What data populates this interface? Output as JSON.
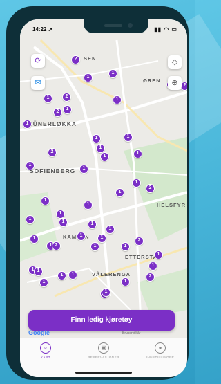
{
  "status_bar": {
    "time": "14:22 ➚",
    "icons": "▮▮ ◠ ▭"
  },
  "map": {
    "districts": [
      "SEN",
      "ØREN",
      "GRÜNERLØKKA",
      "SOFIENBERG",
      "HELSFYR",
      "KAMPEN",
      "ETTERSTAD",
      "VÅLERENGA"
    ],
    "markers": [
      "2",
      "1",
      "1",
      "1",
      "2",
      "1",
      "2",
      "1",
      "1",
      "2",
      "1",
      "1",
      "1",
      "1",
      "2",
      "1",
      "1",
      "1",
      "1",
      "1",
      "2",
      "1",
      "1",
      "1",
      "1",
      "1",
      "1",
      "1",
      "1",
      "1",
      "1",
      "1",
      "1",
      "1",
      "2",
      "1",
      "2",
      "1",
      "1",
      "1",
      "1",
      "1",
      "2",
      "1",
      "1",
      "1",
      "1",
      "1"
    ],
    "google_label": "Google",
    "legal_text": "Brukervilkår"
  },
  "controls": {
    "reload_icon": "reload-icon",
    "messenger_icon": "messenger-icon",
    "compass_icon": "compass-icon",
    "locate_icon": "locate-icon"
  },
  "cta": {
    "label": "Finn ledig kjøretøy"
  },
  "tabs": [
    {
      "label": "KART",
      "icon": "search-icon"
    },
    {
      "label": "RESERVASJONER",
      "icon": "car-icon"
    },
    {
      "label": "INNSTILLINGER",
      "icon": "user-icon"
    }
  ],
  "colors": {
    "accent": "#7b2fc6",
    "frame": "#0e2f38",
    "background": "#4ab6d9"
  }
}
